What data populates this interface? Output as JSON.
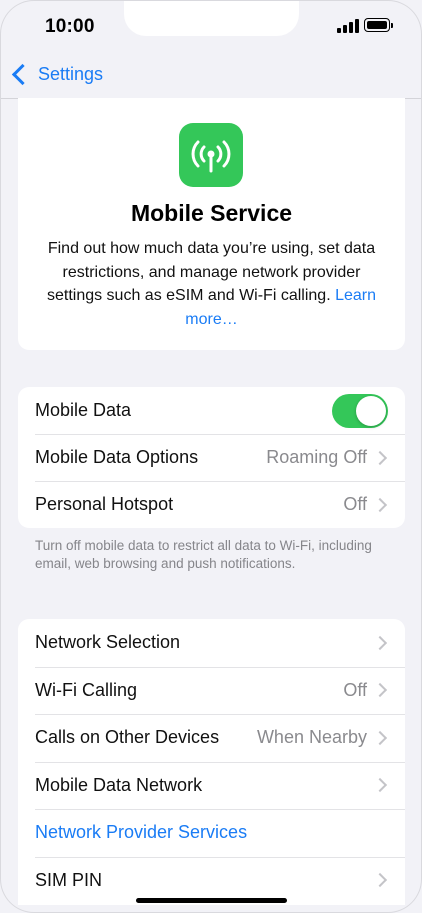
{
  "status_bar": {
    "time": "10:00"
  },
  "nav": {
    "back_label": "Settings"
  },
  "hero": {
    "icon": "antenna-radiowaves-icon",
    "icon_color": "#34c759",
    "title": "Mobile Service",
    "description": "Find out how much data you’re using, set data restrictions, and manage network provider settings such as eSIM and Wi-Fi calling.",
    "link": "Learn more…"
  },
  "group1": {
    "rows": [
      {
        "label": "Mobile Data",
        "toggle_on": true
      },
      {
        "label": "Mobile Data Options",
        "value": "Roaming Off"
      },
      {
        "label": "Personal Hotspot",
        "value": "Off"
      }
    ],
    "footnote": "Turn off mobile data to restrict all data to Wi-Fi, including email, web browsing and push notifications."
  },
  "group2": {
    "rows": [
      {
        "label": "Network Selection",
        "value": ""
      },
      {
        "label": "Wi-Fi Calling",
        "value": "Off"
      },
      {
        "label": "Calls on Other Devices",
        "value": "When Nearby"
      },
      {
        "label": "Mobile Data Network",
        "value": ""
      },
      {
        "label": "Network Provider Services",
        "value": ""
      },
      {
        "label": "SIM PIN",
        "value": ""
      }
    ]
  },
  "colors": {
    "accent": "#1a7cf5",
    "toggle_on": "#34c759"
  }
}
